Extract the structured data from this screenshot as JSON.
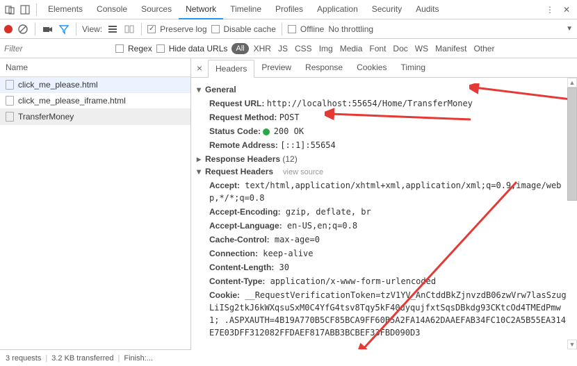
{
  "tabs": {
    "items": [
      "Elements",
      "Console",
      "Sources",
      "Network",
      "Timeline",
      "Profiles",
      "Application",
      "Security",
      "Audits"
    ],
    "active": 3
  },
  "toolbar": {
    "view_label": "View:",
    "preserve_log": "Preserve log",
    "disable_cache": "Disable cache",
    "offline": "Offline",
    "throttling": "No throttling"
  },
  "filterbar": {
    "placeholder": "Filter",
    "regex": "Regex",
    "hide_data_urls": "Hide data URLs",
    "types": [
      "All",
      "XHR",
      "JS",
      "CSS",
      "Img",
      "Media",
      "Font",
      "Doc",
      "WS",
      "Manifest",
      "Other"
    ],
    "selected": 0
  },
  "requests": {
    "header": "Name",
    "items": [
      {
        "name": "click_me_please.html"
      },
      {
        "name": "click_me_please_iframe.html"
      },
      {
        "name": "TransferMoney"
      }
    ],
    "selected": 2
  },
  "detail_tabs": {
    "items": [
      "Headers",
      "Preview",
      "Response",
      "Cookies",
      "Timing"
    ],
    "active": 0
  },
  "general": {
    "title": "General",
    "request_url_k": "Request URL:",
    "request_url_v": "http://localhost:55654/Home/TransferMoney",
    "request_method_k": "Request Method:",
    "request_method_v": "POST",
    "status_code_k": "Status Code:",
    "status_code_v": "200 OK",
    "remote_addr_k": "Remote Address:",
    "remote_addr_v": "[::1]:55654"
  },
  "response_headers": {
    "title": "Response Headers",
    "count": "(12)"
  },
  "request_headers": {
    "title": "Request Headers",
    "view_source": "view source",
    "items": [
      {
        "k": "Accept:",
        "v": "text/html,application/xhtml+xml,application/xml;q=0.9,image/webp,*/*;q=0.8"
      },
      {
        "k": "Accept-Encoding:",
        "v": "gzip, deflate, br"
      },
      {
        "k": "Accept-Language:",
        "v": "en-US,en;q=0.8"
      },
      {
        "k": "Cache-Control:",
        "v": "max-age=0"
      },
      {
        "k": "Connection:",
        "v": "keep-alive"
      },
      {
        "k": "Content-Length:",
        "v": "30"
      },
      {
        "k": "Content-Type:",
        "v": "application/x-www-form-urlencoded"
      },
      {
        "k": "Cookie:",
        "v": "__RequestVerificationToken=tzV1YV_AnCtddBkZjnvzdB06zwVrw7lasSzugLiISg2tkJ6kWXqsuSxM0C4YfG4tsv8Tqy5kF40uyqujfxtSqsDBkdg93CKtcOd4TMEdPmw1; .ASPXAUTH=4B19A770B5CF85BCA9FF60B5A2FA14A62DAAEFAB34FC10C2A5B55EA314E7E03DFF312082FFDAEF817ABB3BCBEF33FBD090D3"
      }
    ]
  },
  "footer": {
    "requests": "3 requests",
    "transferred": "3.2 KB transferred",
    "finish": "Finish:..."
  }
}
